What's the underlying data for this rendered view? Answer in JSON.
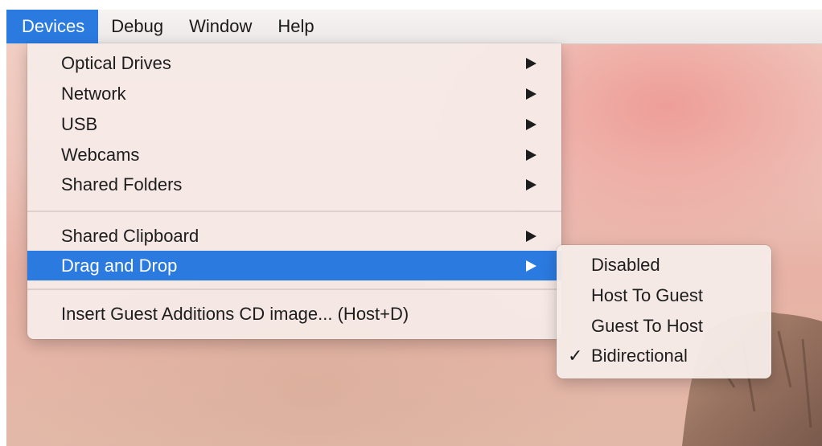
{
  "menubar": {
    "items": [
      {
        "label": "Devices"
      },
      {
        "label": "Debug"
      },
      {
        "label": "Window"
      },
      {
        "label": "Help"
      }
    ]
  },
  "devices_menu": {
    "items": [
      {
        "label": "Optical Drives",
        "submenu": true
      },
      {
        "label": "Network",
        "submenu": true
      },
      {
        "label": "USB",
        "submenu": true
      },
      {
        "label": "Webcams",
        "submenu": true
      },
      {
        "label": "Shared Folders",
        "submenu": true
      },
      {
        "label": "Shared Clipboard",
        "submenu": true
      },
      {
        "label": "Drag and Drop",
        "submenu": true,
        "highlighted": true
      },
      {
        "label": "Insert Guest Additions CD image... (Host+D)",
        "submenu": false
      }
    ]
  },
  "drag_and_drop_submenu": {
    "items": [
      {
        "label": "Disabled",
        "checked": false
      },
      {
        "label": "Host To Guest",
        "checked": false
      },
      {
        "label": "Guest To Host",
        "checked": false
      },
      {
        "label": "Bidirectional",
        "checked": true
      }
    ],
    "checkmark": "✓"
  },
  "colors": {
    "highlight": "#2a7ae0",
    "menu_background": "#f6ece8",
    "text": "#1d1d1d"
  }
}
